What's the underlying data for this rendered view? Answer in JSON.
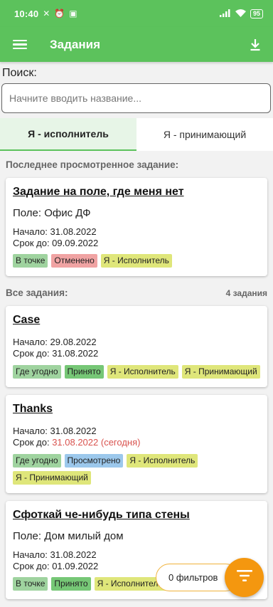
{
  "status_bar": {
    "time": "10:40",
    "battery": "95"
  },
  "app_bar": {
    "title": "Задания"
  },
  "search": {
    "label": "Поиск:",
    "placeholder": "Начните вводить название...",
    "value": ""
  },
  "tabs": [
    {
      "label": "Я - исполнитель",
      "active": true
    },
    {
      "label": "Я - принимающий",
      "active": false
    }
  ],
  "last_viewed": {
    "heading": "Последнее просмотренное задание:",
    "task": {
      "title": "Задание на поле, где меня нет",
      "field": "Поле: Офис ДФ",
      "start": "Начало:  31.08.2022",
      "due": "Срок до: 09.09.2022",
      "badges": [
        {
          "text": "В точке",
          "color": "#9fd39f"
        },
        {
          "text": "Отменено",
          "color": "#f0a3a3"
        },
        {
          "text": "Я - Исполнитель",
          "color": "#dfe67a"
        }
      ]
    }
  },
  "all_tasks": {
    "heading": "Все задания:",
    "count": "4 задания",
    "items": [
      {
        "title": "Case",
        "start": "Начало:  29.08.2022",
        "due_label": "Срок до: ",
        "due_value": "31.08.2022",
        "badges": [
          {
            "text": "Где угодно",
            "color": "#9fd39f"
          },
          {
            "text": "Принято",
            "color": "#76c776"
          },
          {
            "text": "Я - Исполнитель",
            "color": "#dfe67a"
          },
          {
            "text": "Я - Принимающий",
            "color": "#dfe67a"
          }
        ]
      },
      {
        "title": "Thanks",
        "start": "Начало:  31.08.2022",
        "due_label": "Срок до: ",
        "due_value": "31.08.2022 (сегодня)",
        "badges": [
          {
            "text": "Где угодно",
            "color": "#9fd39f"
          },
          {
            "text": "Просмотрено",
            "color": "#9cc8ec"
          },
          {
            "text": "Я - Исполнитель",
            "color": "#dfe67a"
          },
          {
            "text": "Я - Принимающий",
            "color": "#dfe67a"
          }
        ]
      },
      {
        "title": "Сфоткай че-нибудь типа стены",
        "field": "Поле: Дом милый дом",
        "start": "Начало:  31.08.2022",
        "due_label": "Срок до: ",
        "due_value": "01.09.2022",
        "badges": [
          {
            "text": "В точке",
            "color": "#9fd39f"
          },
          {
            "text": "Принято",
            "color": "#76c776"
          },
          {
            "text": "Я - Исполнитель",
            "color": "#dfe67a"
          }
        ]
      }
    ]
  },
  "filter": {
    "label": "0 фильтров"
  }
}
